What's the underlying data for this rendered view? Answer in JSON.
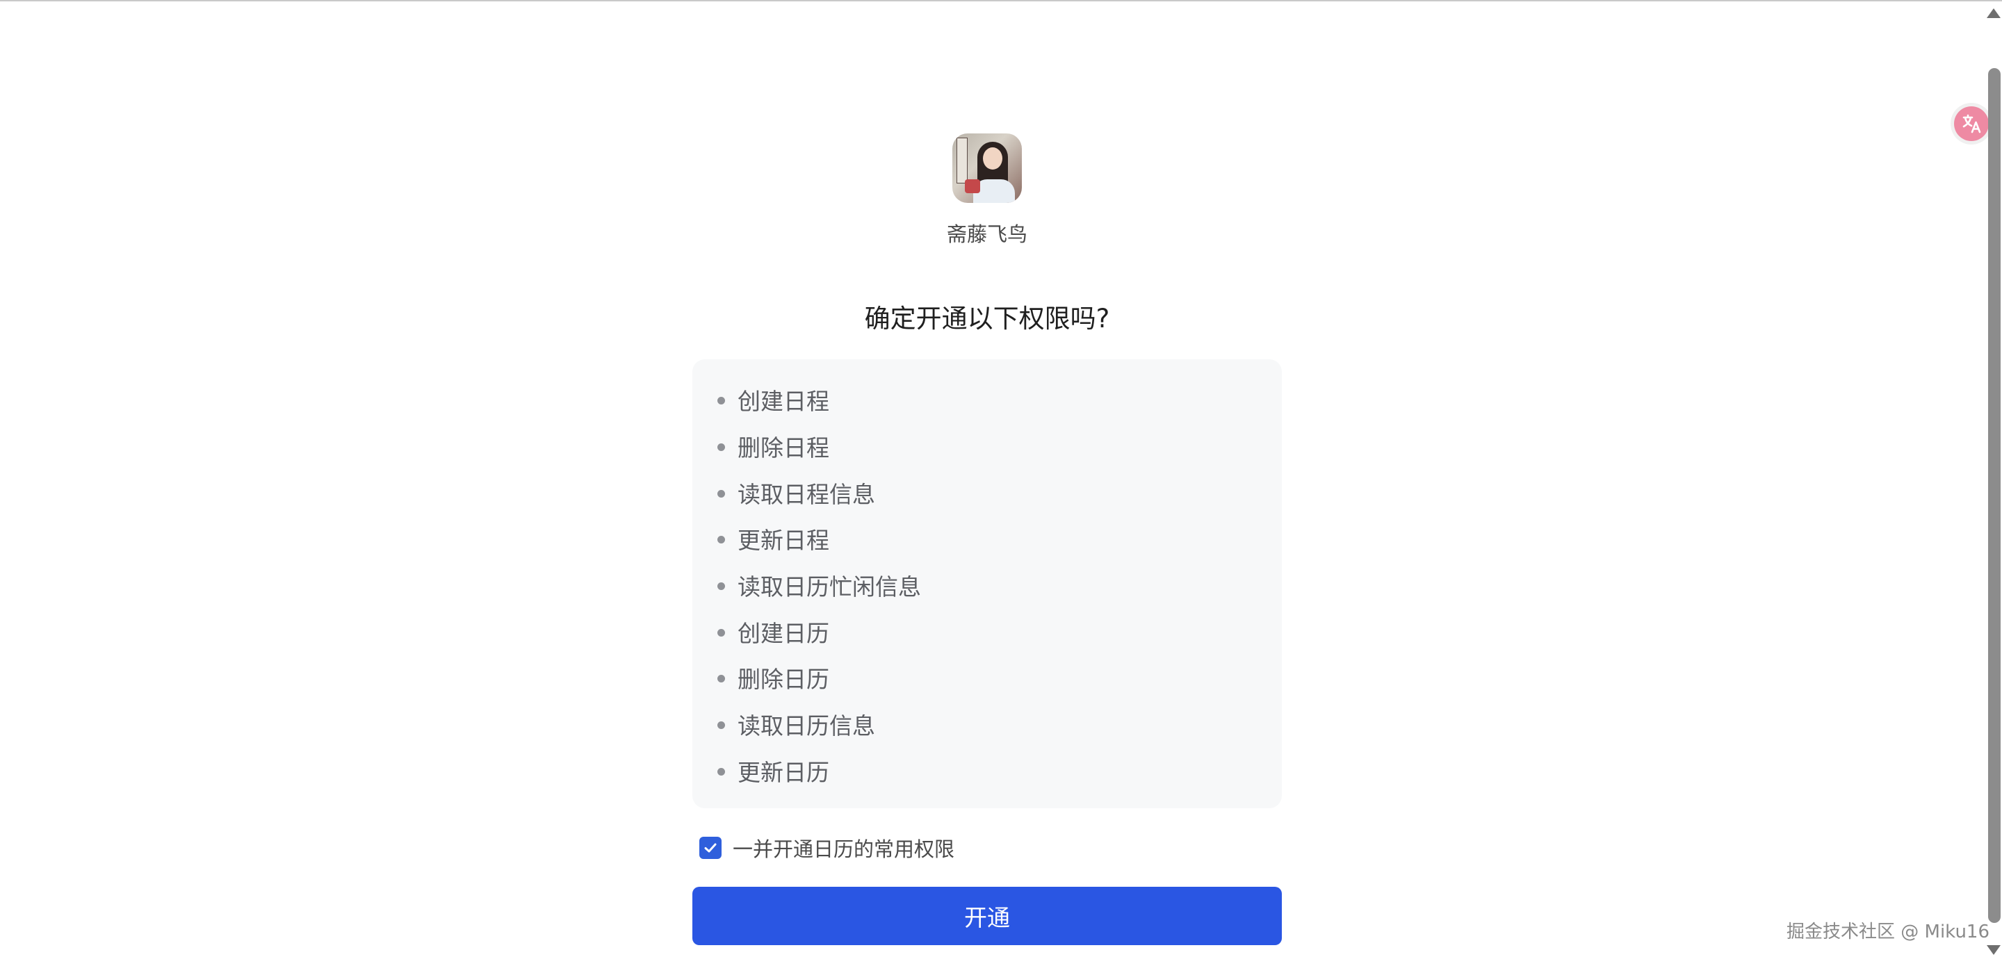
{
  "user": {
    "name": "斋藤飞鸟"
  },
  "title": "确定开通以下权限吗?",
  "permissions": [
    {
      "label": "创建日程"
    },
    {
      "label": "删除日程"
    },
    {
      "label": "读取日程信息"
    },
    {
      "label": "更新日程"
    },
    {
      "label": "读取日历忙闲信息"
    },
    {
      "label": "创建日历"
    },
    {
      "label": "删除日历"
    },
    {
      "label": "读取日历信息"
    },
    {
      "label": "更新日历"
    }
  ],
  "checkbox": {
    "label": "一并开通日历的常用权限",
    "checked": true
  },
  "primary_button": {
    "label": "开通"
  },
  "watermark": {
    "text": "掘金技术社区 @ Miku16"
  },
  "colors": {
    "primary": "#2a56e3",
    "checkbox": "#2f5fdc",
    "perm_box_bg": "#f7f8f9",
    "translate_fab": "#ee8aa3"
  },
  "icons": {
    "translate": "translate-icon",
    "check": "check-icon"
  }
}
